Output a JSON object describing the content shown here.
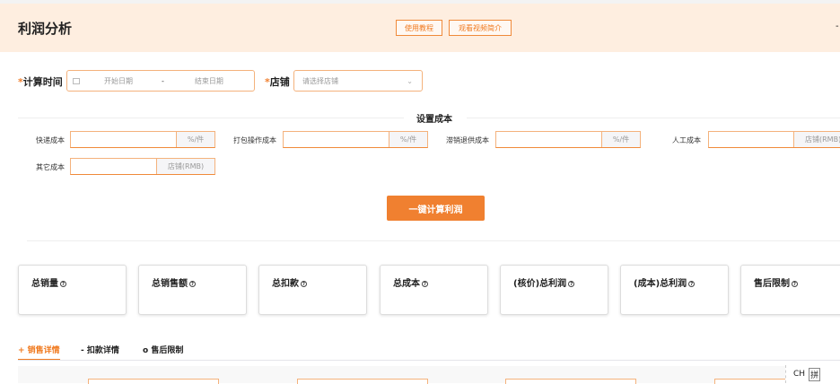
{
  "header": {
    "title": "利润分析",
    "buttons": [
      "使用教程",
      "观看视频简介"
    ]
  },
  "filters": {
    "time_label": "计算时间",
    "start_placeholder": "开始日期",
    "separator": "-",
    "end_placeholder": "结束日期",
    "shop_label": "店铺",
    "shop_placeholder": "请选择店铺",
    "required_mark": "*"
  },
  "costs": {
    "section_title": "设置成本",
    "items": [
      {
        "label": "快递成本",
        "unit": "%/件",
        "value": ""
      },
      {
        "label": "打包操作成本",
        "unit": "%/件",
        "value": ""
      },
      {
        "label": "滞销退供成本",
        "unit": "%/件",
        "value": ""
      },
      {
        "label": "人工成本",
        "unit": "店铺(RMB)",
        "value": ""
      },
      {
        "label": "其它成本",
        "unit": "店铺(RMB)",
        "value": ""
      }
    ]
  },
  "calc_button": "一键计算利润",
  "cards": [
    "总销量",
    "总销售额",
    "总扣款",
    "总成本",
    "(核价)总利润",
    "(成本)总利润",
    "售后限制"
  ],
  "tabs": [
    "+ 销售详情",
    "- 扣款详情",
    "o 售后限制"
  ],
  "ime": {
    "mode": "CH",
    "pin": "拼"
  }
}
